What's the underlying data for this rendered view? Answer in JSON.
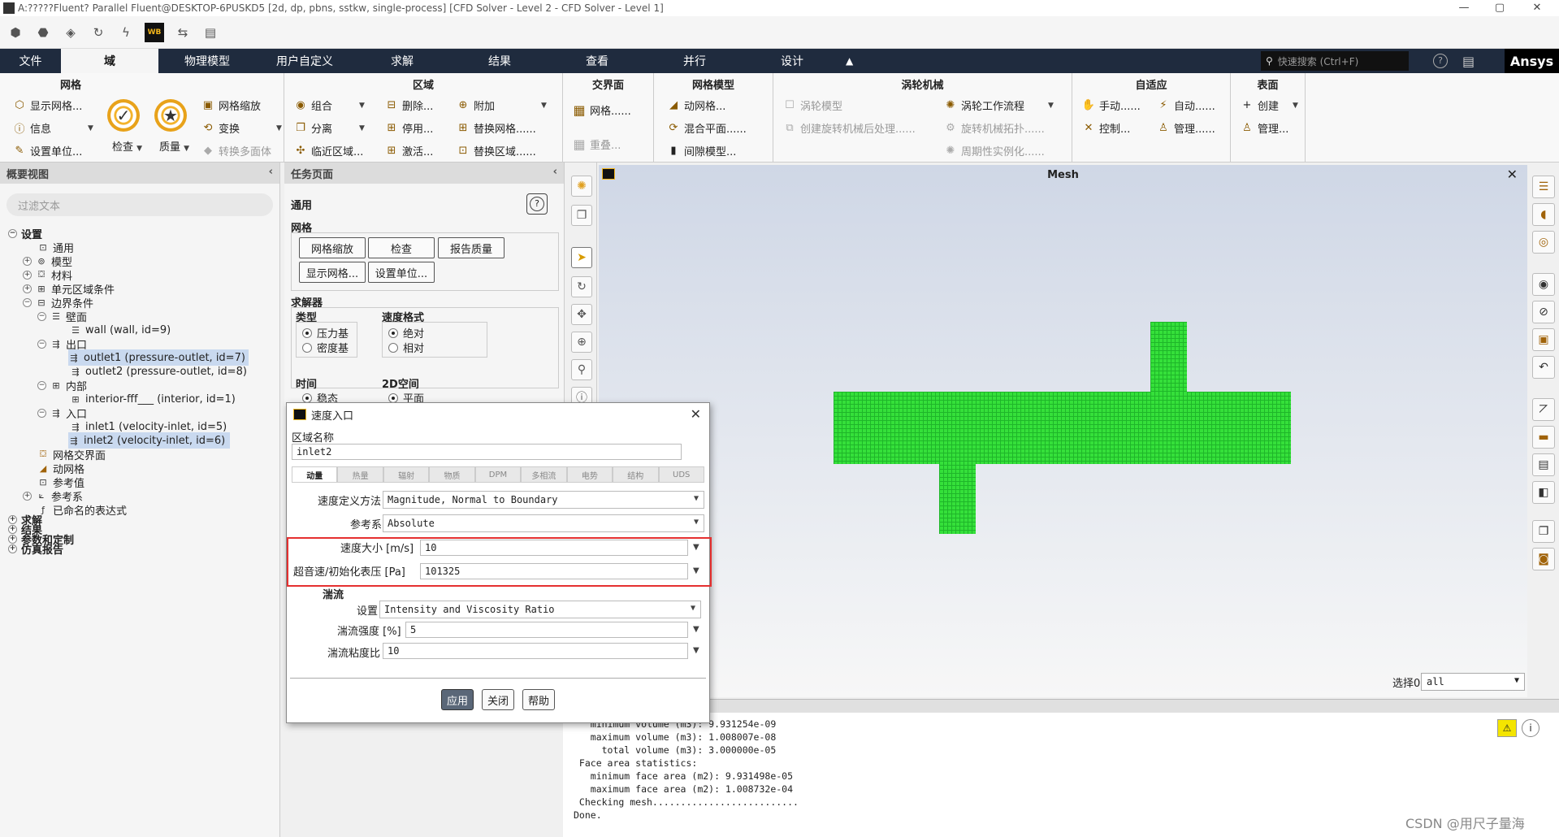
{
  "window": {
    "title": "A:?????Fluent? Parallel Fluent@DESKTOP-6PUSKD5  [2d, dp, pbns, sstkw, single-process] [CFD Solver - Level 2 - CFD Solver - Level 1]"
  },
  "menu": {
    "tabs": [
      "文件",
      "域",
      "物理模型",
      "用户自定义",
      "求解",
      "结果",
      "查看",
      "并行",
      "设计"
    ],
    "active": "域",
    "search_placeholder": "快速搜索 (Ctrl+F)",
    "logo": "Ansys"
  },
  "ribbon": {
    "mesh": {
      "title": "网格",
      "display_mesh": "显示网格...",
      "info": "信息",
      "set_units": "设置单位...",
      "check": "检查",
      "quality": "质量",
      "scale": "网格缩放",
      "transform": "变换",
      "to_polyhedra": "转换多面体"
    },
    "zones": {
      "title": "区域",
      "combine": "组合",
      "separate": "分离",
      "adjacency": "临近区域...",
      "delete": "删除...",
      "deactivate": "停用...",
      "activate": "激活...",
      "append": "附加",
      "replace_mesh": "替换网格......",
      "replace_zone": "替换区域......"
    },
    "interfaces": {
      "title": "交界面",
      "mesh": "网格......",
      "overlap": "重叠..."
    },
    "mesh_models": {
      "title": "网格模型",
      "dynamic": "动网格...",
      "mixing_plane": "混合平面......",
      "gap": "间隙模型..."
    },
    "turbo": {
      "title": "涡轮机械",
      "turbo_model": "涡轮模型",
      "create_post": "创建旋转机械后处理......",
      "workflow": "涡轮工作流程",
      "topology": "旋转机械拓扑......",
      "periodic": "周期性实例化......"
    },
    "adapt": {
      "title": "自适应",
      "manual": "手动......",
      "automatic": "自动......",
      "control": "控制...",
      "manage": "管理......"
    },
    "surface": {
      "title": "表面",
      "create": "创建",
      "manage": "管理..."
    }
  },
  "outline": {
    "title": "概要视图",
    "filter_placeholder": "过滤文本",
    "setup": "设置",
    "general": "通用",
    "models": "模型",
    "materials": "材料",
    "cell_zone": "单元区域条件",
    "boundary": "边界条件",
    "wall_group": "壁面",
    "wall": "wall (wall, id=9)",
    "outlet_group": "出口",
    "outlet1": "outlet1 (pressure-outlet, id=7)",
    "outlet2": "outlet2 (pressure-outlet, id=8)",
    "interior_group": "内部",
    "interior": "interior-fff___ (interior, id=1)",
    "inlet_group": "入口",
    "inlet1": "inlet1 (velocity-inlet, id=5)",
    "inlet2": "inlet2 (velocity-inlet, id=6)",
    "mesh_interfaces": "网格交界面",
    "dynamic_mesh": "动网格",
    "reference_values": "参考值",
    "reference_frames": "参考系",
    "named_expressions": "已命名的表达式",
    "solution": "求解",
    "results": "结果",
    "parameters": "参数和定制",
    "report": "仿真报告"
  },
  "task": {
    "title": "任务页面",
    "general": "通用",
    "mesh": "网格",
    "btn_scale": "网格缩放",
    "btn_check": "检查",
    "btn_quality": "报告质量",
    "btn_display": "显示网格...",
    "btn_units": "设置单位...",
    "solver": "求解器",
    "type": "类型",
    "pressure_based": "压力基",
    "density_based": "密度基",
    "velocity_formulation": "速度格式",
    "absolute": "绝对",
    "relative": "相对",
    "time": "时间",
    "steady": "稳态",
    "space_2d": "2D空间",
    "planar": "平面"
  },
  "graphics": {
    "title": "Mesh",
    "select_label": "选择0",
    "select_value": "all"
  },
  "console": {
    "lines": [
      "   minimum volume (m3): 9.931254e-09",
      "   maximum volume (m3): 1.008007e-08",
      "     total volume (m3): 3.000000e-05",
      " Face area statistics:",
      "   minimum face area (m2): 9.931498e-05",
      "   maximum face area (m2): 1.008732e-04",
      " Checking mesh..........................",
      "Done."
    ],
    "watermark": "CSDN @用尺子量海"
  },
  "dialog": {
    "title": "速度入口",
    "zone_name_label": "区域名称",
    "zone_name": "inlet2",
    "tabs": [
      "动量",
      "热量",
      "辐射",
      "物质",
      "DPM",
      "多相流",
      "电势",
      "结构",
      "UDS"
    ],
    "active_tab": "动量",
    "spec_method_label": "速度定义方法",
    "spec_method": "Magnitude, Normal to Boundary",
    "ref_frame_label": "参考系",
    "ref_frame": "Absolute",
    "velocity_label": "速度大小 [m/s]",
    "velocity": "10",
    "pressure_label": "超音速/初始化表压 [Pa]",
    "pressure": "101325",
    "turbulence": "湍流",
    "setting_label": "设置",
    "setting": "Intensity and Viscosity Ratio",
    "intensity_label": "湍流强度 [%]",
    "intensity": "5",
    "viscosity_label": "湍流粘度比",
    "viscosity": "10",
    "apply": "应用",
    "close": "关闭",
    "help": "帮助"
  },
  "colors": {
    "menubar": "#1f2b3e",
    "mesh": "#35e03a",
    "highlight": "#e53030",
    "accent": "#f3b32c"
  }
}
